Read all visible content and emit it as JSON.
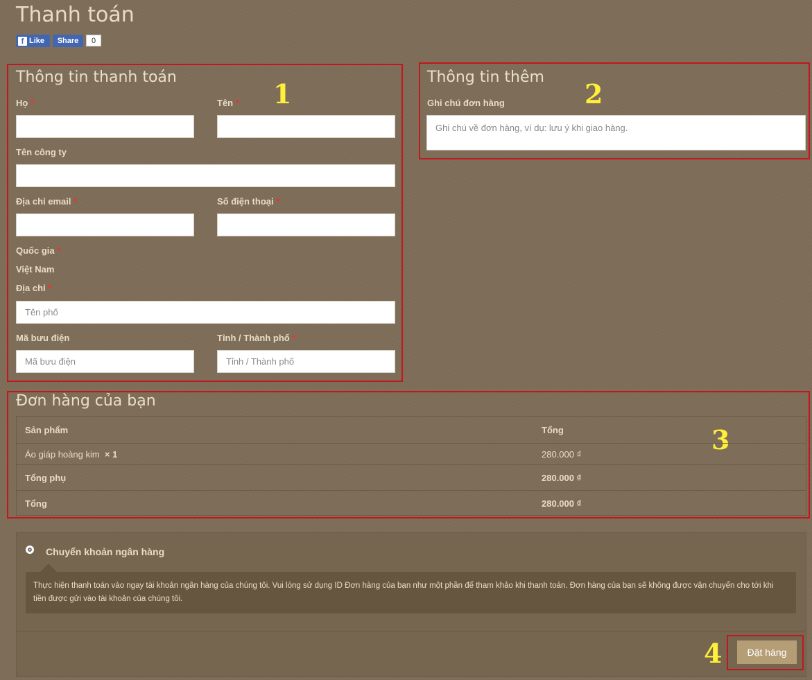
{
  "page": {
    "title": "Thanh toán",
    "social": {
      "like_label": "Like",
      "share_label": "Share",
      "count": "0",
      "fb_glyph": "f"
    }
  },
  "billing": {
    "title": "Thông tin thanh toán",
    "annotation": "1",
    "required_mark": "*",
    "last_name_label": "Họ",
    "first_name_label": "Tên",
    "company_label": "Tên công ty",
    "email_label": "Địa chỉ email",
    "phone_label": "Số điện thoại",
    "country_label": "Quốc gia",
    "country_value": "Việt Nam",
    "address_label": "Địa chỉ",
    "address_placeholder": "Tên phố",
    "postcode_label": "Mã bưu điện",
    "postcode_placeholder": "Mã bưu điện",
    "city_label": "Tỉnh / Thành phố",
    "city_placeholder": "Tỉnh / Thành phố"
  },
  "additional": {
    "title": "Thông tin thêm",
    "annotation": "2",
    "notes_label": "Ghi chú đơn hàng",
    "notes_placeholder": "Ghi chú về đơn hàng, ví dụ: lưu ý khi giao hàng."
  },
  "order": {
    "title": "Đơn hàng của bạn",
    "annotation": "3",
    "col_product": "Sản phẩm",
    "col_total": "Tổng",
    "item_name": "Áo giáp hoàng kim",
    "item_qty": "× 1",
    "item_total": "280.000 ₫",
    "subtotal_label": "Tổng phụ",
    "subtotal_value": "280.000 ₫",
    "total_label": "Tổng",
    "total_value": "280.000 ₫"
  },
  "payment": {
    "method_label": "Chuyển khoản ngân hàng",
    "description": "Thực hiện thanh toán vào ngay tài khoản ngân hàng của chúng tôi. Vui lòng sử dụng ID Đơn hàng của bạn như một phần để tham khảo khi thanh toán. Đơn hàng của bạn sẽ không được vận chuyển cho tới khi tiền được gửi vào tài khoản của chúng tôi.",
    "place_order_label": "Đặt hàng",
    "annotation": "4"
  },
  "colors": {
    "highlight": "#c4161c",
    "annotation": "#ffef3a",
    "button": "#b59e76",
    "required": "#ff2a2a"
  }
}
